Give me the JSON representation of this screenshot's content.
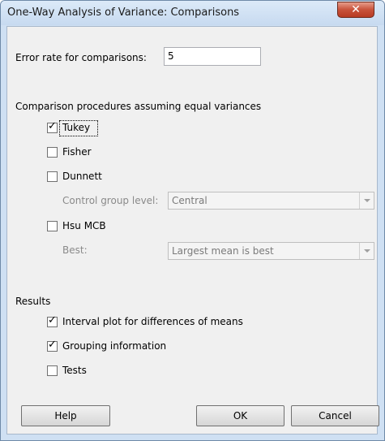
{
  "window": {
    "title": "One-Way Analysis of Variance: Comparisons",
    "close_glyph": "✕"
  },
  "error_rate": {
    "label": "Error rate for comparisons:",
    "value": "5"
  },
  "procedures": {
    "heading": "Comparison procedures assuming equal variances",
    "tukey": {
      "label": "Tukey",
      "checked": true
    },
    "fisher": {
      "label": "Fisher",
      "checked": false
    },
    "dunnett": {
      "label": "Dunnett",
      "checked": false
    },
    "control_group": {
      "label": "Control group level:",
      "value": "Central"
    },
    "hsu": {
      "label": "Hsu MCB",
      "checked": false
    },
    "best": {
      "label": "Best:",
      "value": "Largest mean is best"
    }
  },
  "results": {
    "heading": "Results",
    "interval_plot": {
      "label": "Interval plot for differences of means",
      "checked": true
    },
    "grouping": {
      "label": "Grouping information",
      "checked": true
    },
    "tests": {
      "label": "Tests",
      "checked": false
    }
  },
  "buttons": {
    "help": "Help",
    "ok": "OK",
    "cancel": "Cancel"
  },
  "checkmark_glyph": "✓"
}
